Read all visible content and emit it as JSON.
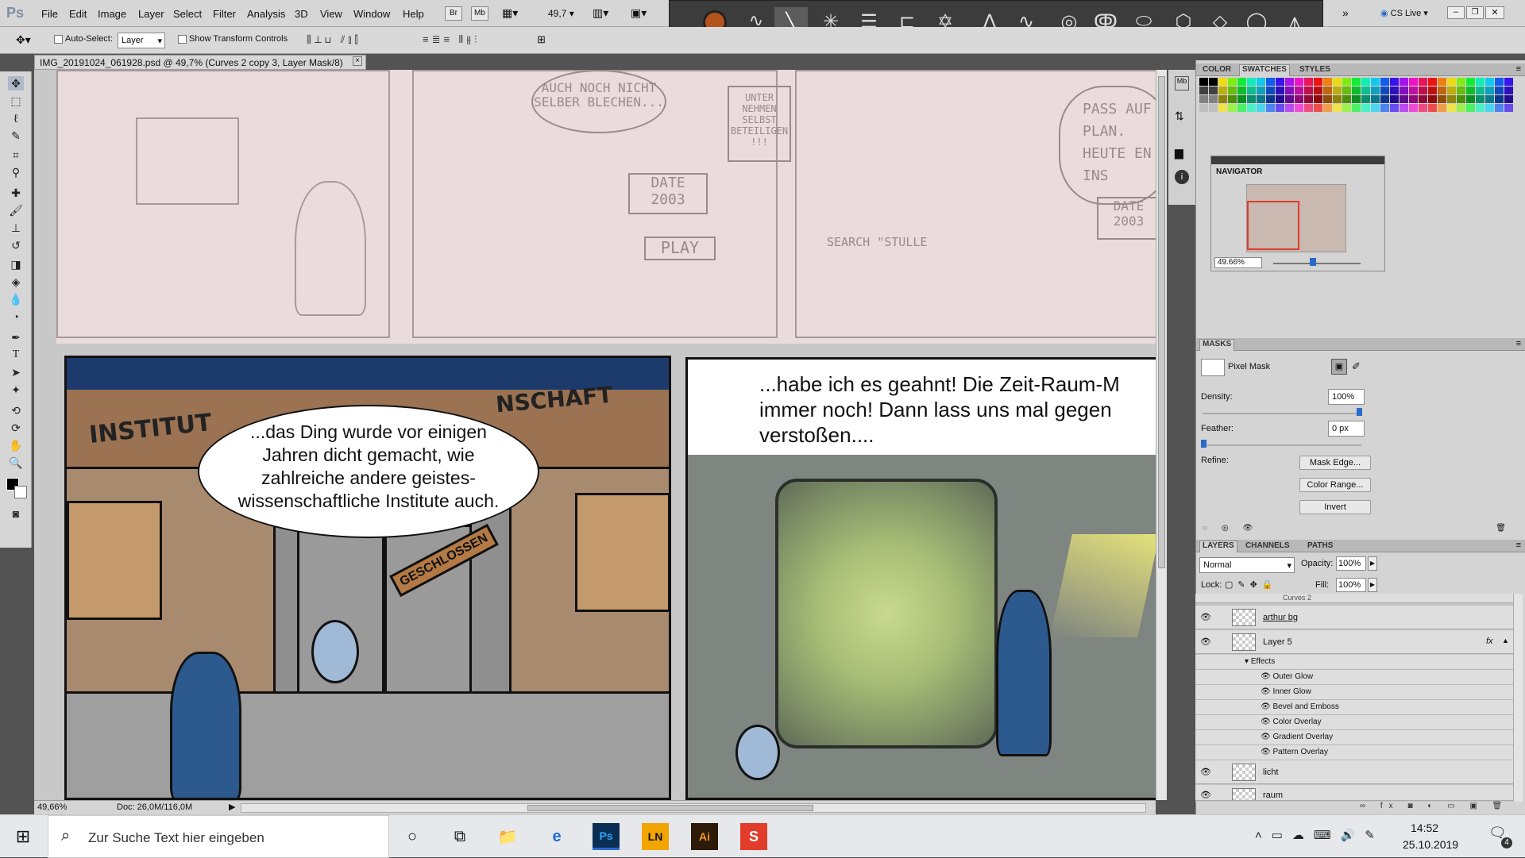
{
  "app": {
    "logo": "Ps"
  },
  "menu": {
    "items": [
      "File",
      "Edit",
      "Image",
      "Layer",
      "Select",
      "Filter",
      "Analysis",
      "3D",
      "View",
      "Window",
      "Help"
    ],
    "mini_bridge": "Br",
    "mini_mb": "Mb",
    "zoom_value": "49,7",
    "more_label": "»",
    "cs_live": "CS Live"
  },
  "options_bar": {
    "auto_select_label": "Auto-Select:",
    "auto_select_value": "Layer",
    "show_transform_label": "Show Transform Controls"
  },
  "document": {
    "tab_title": "IMG_20191024_061928.psd @ 49,7% (Curves 2 copy 3, Layer Mask/8)",
    "close_glyph": "×"
  },
  "comic": {
    "sketch_texts": [
      "AUCH NOCH NICHT SELBER BLECHEN...",
      "UNTER NEHMEN SELBST BETEILIGEN !!!",
      "DATE 2003",
      "PLAY",
      "SEARCH \"STULLE",
      "PASS AUF PLAN. HEUTE EN INS",
      "DATE 2003"
    ],
    "sign_institut": "INSTITUT",
    "sign_schaft": "NSCHAFT",
    "sign_geschlossen": "GESCHLOSSEN",
    "bubble_left": "...das Ding wurde vor einigen Jahren dicht gemacht, wie zahlreiche andere geistes- wissenschaftliche Institute auch.",
    "caption_right_line1": "...habe ich es geahnt! Die Zeit-Raum-M",
    "caption_right_line2": "immer noch! Dann lass uns mal gegen",
    "caption_right_line3": "verstoßen...."
  },
  "status": {
    "zoom": "49,66%",
    "doc_size": "Doc: 26,0M/116,0M"
  },
  "panels": {
    "color_tabs": [
      "COLOR",
      "SWATCHES",
      "STYLES"
    ],
    "color_tab_active": "SWATCHES",
    "navigator_title": "NAVIGATOR",
    "navigator_zoom": "49.66%",
    "masks_title": "MASKS",
    "pixel_mask_label": "Pixel Mask",
    "density_label": "Density:",
    "density_value": "100%",
    "feather_label": "Feather:",
    "feather_value": "0 px",
    "refine_label": "Refine:",
    "mask_edge_button": "Mask Edge...",
    "color_range_button": "Color Range...",
    "invert_button": "Invert",
    "layers_tabs": [
      "LAYERS",
      "CHANNELS",
      "PATHS"
    ],
    "layers_tab_active": "LAYERS",
    "blend_mode": "Normal",
    "opacity_label": "Opacity:",
    "opacity_value": "100%",
    "lock_label": "Lock:",
    "fill_label": "Fill:",
    "fill_value": "100%",
    "partial_layer": "Curves 2",
    "layers": [
      {
        "name": "arthur bg",
        "visible": true
      },
      {
        "name": "Layer 5",
        "visible": true,
        "fx": "fx"
      },
      {
        "name": "licht",
        "visible": true
      },
      {
        "name": "raum",
        "visible": true
      }
    ],
    "effects_label": "Effects",
    "effects": [
      "Outer Glow",
      "Inner Glow",
      "Bevel and Emboss",
      "Color Overlay",
      "Gradient Overlay",
      "Pattern Overlay"
    ]
  },
  "taskbar": {
    "search_placeholder": "Zur Suche Text hier eingeben",
    "time": "14:52",
    "date": "25.10.2019",
    "notification_count": "4",
    "apps": [
      "task-view",
      "file-explorer",
      "edge",
      "photoshop",
      "lightroom",
      "illustrator",
      "smartsheet"
    ]
  },
  "colors": {
    "ps_blue": "#1c3a6b",
    "accent_blue": "#2a6ac8",
    "sketch_bg": "#eadcdc",
    "taskbar": "#e6e8ec"
  }
}
